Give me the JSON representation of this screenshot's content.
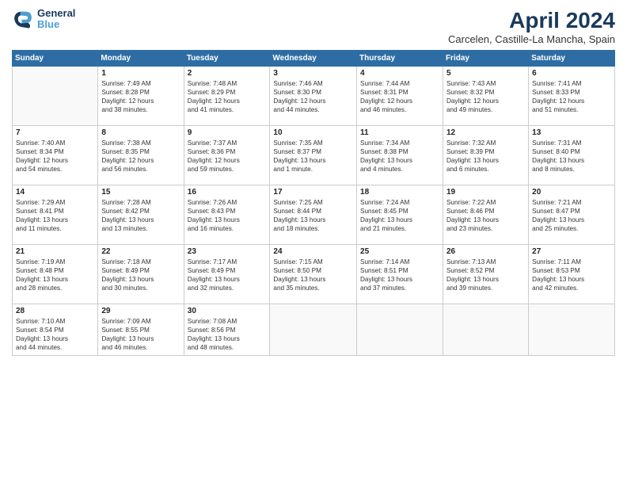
{
  "header": {
    "logo_line1": "General",
    "logo_line2": "Blue",
    "month_title": "April 2024",
    "subtitle": "Carcelen, Castille-La Mancha, Spain"
  },
  "columns": [
    "Sunday",
    "Monday",
    "Tuesday",
    "Wednesday",
    "Thursday",
    "Friday",
    "Saturday"
  ],
  "weeks": [
    [
      {
        "day": "",
        "info": ""
      },
      {
        "day": "1",
        "info": "Sunrise: 7:49 AM\nSunset: 8:28 PM\nDaylight: 12 hours\nand 38 minutes."
      },
      {
        "day": "2",
        "info": "Sunrise: 7:48 AM\nSunset: 8:29 PM\nDaylight: 12 hours\nand 41 minutes."
      },
      {
        "day": "3",
        "info": "Sunrise: 7:46 AM\nSunset: 8:30 PM\nDaylight: 12 hours\nand 44 minutes."
      },
      {
        "day": "4",
        "info": "Sunrise: 7:44 AM\nSunset: 8:31 PM\nDaylight: 12 hours\nand 46 minutes."
      },
      {
        "day": "5",
        "info": "Sunrise: 7:43 AM\nSunset: 8:32 PM\nDaylight: 12 hours\nand 49 minutes."
      },
      {
        "day": "6",
        "info": "Sunrise: 7:41 AM\nSunset: 8:33 PM\nDaylight: 12 hours\nand 51 minutes."
      }
    ],
    [
      {
        "day": "7",
        "info": "Sunrise: 7:40 AM\nSunset: 8:34 PM\nDaylight: 12 hours\nand 54 minutes."
      },
      {
        "day": "8",
        "info": "Sunrise: 7:38 AM\nSunset: 8:35 PM\nDaylight: 12 hours\nand 56 minutes."
      },
      {
        "day": "9",
        "info": "Sunrise: 7:37 AM\nSunset: 8:36 PM\nDaylight: 12 hours\nand 59 minutes."
      },
      {
        "day": "10",
        "info": "Sunrise: 7:35 AM\nSunset: 8:37 PM\nDaylight: 13 hours\nand 1 minute."
      },
      {
        "day": "11",
        "info": "Sunrise: 7:34 AM\nSunset: 8:38 PM\nDaylight: 13 hours\nand 4 minutes."
      },
      {
        "day": "12",
        "info": "Sunrise: 7:32 AM\nSunset: 8:39 PM\nDaylight: 13 hours\nand 6 minutes."
      },
      {
        "day": "13",
        "info": "Sunrise: 7:31 AM\nSunset: 8:40 PM\nDaylight: 13 hours\nand 8 minutes."
      }
    ],
    [
      {
        "day": "14",
        "info": "Sunrise: 7:29 AM\nSunset: 8:41 PM\nDaylight: 13 hours\nand 11 minutes."
      },
      {
        "day": "15",
        "info": "Sunrise: 7:28 AM\nSunset: 8:42 PM\nDaylight: 13 hours\nand 13 minutes."
      },
      {
        "day": "16",
        "info": "Sunrise: 7:26 AM\nSunset: 8:43 PM\nDaylight: 13 hours\nand 16 minutes."
      },
      {
        "day": "17",
        "info": "Sunrise: 7:25 AM\nSunset: 8:44 PM\nDaylight: 13 hours\nand 18 minutes."
      },
      {
        "day": "18",
        "info": "Sunrise: 7:24 AM\nSunset: 8:45 PM\nDaylight: 13 hours\nand 21 minutes."
      },
      {
        "day": "19",
        "info": "Sunrise: 7:22 AM\nSunset: 8:46 PM\nDaylight: 13 hours\nand 23 minutes."
      },
      {
        "day": "20",
        "info": "Sunrise: 7:21 AM\nSunset: 8:47 PM\nDaylight: 13 hours\nand 25 minutes."
      }
    ],
    [
      {
        "day": "21",
        "info": "Sunrise: 7:19 AM\nSunset: 8:48 PM\nDaylight: 13 hours\nand 28 minutes."
      },
      {
        "day": "22",
        "info": "Sunrise: 7:18 AM\nSunset: 8:49 PM\nDaylight: 13 hours\nand 30 minutes."
      },
      {
        "day": "23",
        "info": "Sunrise: 7:17 AM\nSunset: 8:49 PM\nDaylight: 13 hours\nand 32 minutes."
      },
      {
        "day": "24",
        "info": "Sunrise: 7:15 AM\nSunset: 8:50 PM\nDaylight: 13 hours\nand 35 minutes."
      },
      {
        "day": "25",
        "info": "Sunrise: 7:14 AM\nSunset: 8:51 PM\nDaylight: 13 hours\nand 37 minutes."
      },
      {
        "day": "26",
        "info": "Sunrise: 7:13 AM\nSunset: 8:52 PM\nDaylight: 13 hours\nand 39 minutes."
      },
      {
        "day": "27",
        "info": "Sunrise: 7:11 AM\nSunset: 8:53 PM\nDaylight: 13 hours\nand 42 minutes."
      }
    ],
    [
      {
        "day": "28",
        "info": "Sunrise: 7:10 AM\nSunset: 8:54 PM\nDaylight: 13 hours\nand 44 minutes."
      },
      {
        "day": "29",
        "info": "Sunrise: 7:09 AM\nSunset: 8:55 PM\nDaylight: 13 hours\nand 46 minutes."
      },
      {
        "day": "30",
        "info": "Sunrise: 7:08 AM\nSunset: 8:56 PM\nDaylight: 13 hours\nand 48 minutes."
      },
      {
        "day": "",
        "info": ""
      },
      {
        "day": "",
        "info": ""
      },
      {
        "day": "",
        "info": ""
      },
      {
        "day": "",
        "info": ""
      }
    ]
  ]
}
